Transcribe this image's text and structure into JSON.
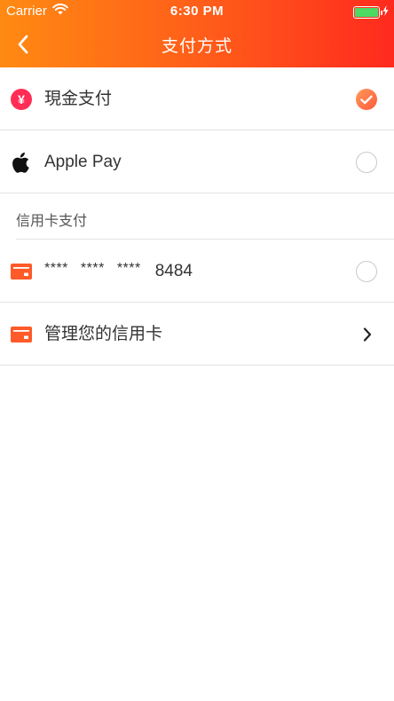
{
  "status_bar": {
    "carrier": "Carrier",
    "time": "6:30 PM",
    "battery_level": 1.0,
    "battery_color": "#4cd964"
  },
  "nav": {
    "title": "支付方式",
    "back_icon": "chevron-left-icon"
  },
  "theme": {
    "gradient_start": "#ff8a12",
    "gradient_end": "#ff2a1e",
    "accent": "#ff5a1a"
  },
  "payment_options": [
    {
      "label": "現金支付",
      "icon": "yen-icon",
      "selected": true
    },
    {
      "label": "Apple Pay",
      "icon": "apple-icon",
      "selected": false
    }
  ],
  "credit_section": {
    "header": "信用卡支付",
    "card": {
      "mask_groups": [
        "****",
        "****",
        "****"
      ],
      "last4": "8484",
      "icon": "credit-card-icon",
      "selected": false
    },
    "manage": {
      "label": "管理您的信用卡",
      "icon": "credit-card-icon"
    }
  }
}
